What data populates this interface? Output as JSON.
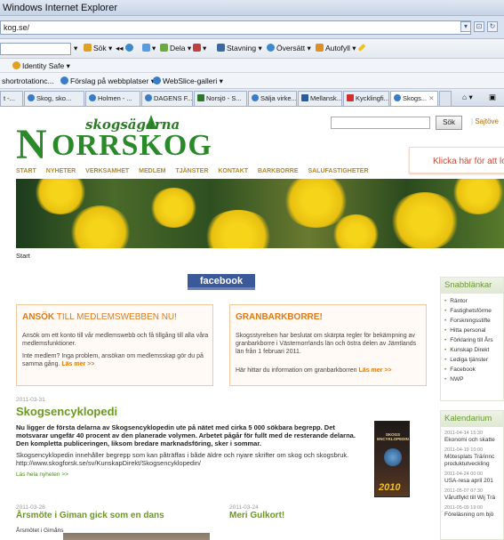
{
  "window": {
    "title": "Windows Internet Explorer"
  },
  "address": {
    "url": "kog.se/"
  },
  "command_bar": {
    "search_label": "Sök",
    "share_label": "Dela",
    "spelling_label": "Stavning",
    "translate_label": "Översätt",
    "autofill_label": "Autofyll"
  },
  "identity": {
    "label": "Identity Safe"
  },
  "favorites": {
    "item1": "shortrotationc...",
    "item2": "Förslag på webbplatser",
    "item3": "WebSlice-galleri"
  },
  "tabs": [
    "t -...",
    "Skog, sko...",
    "Holmen - ...",
    "DAGENS F...",
    "Norsjö - S...",
    "Sälja virke...",
    "Mellansk...",
    "Kycklingfi...",
    "Skogs..."
  ],
  "site": {
    "logo_sub": "skogsägarna",
    "logo_main": "ORRSKOG",
    "logo_n": "N",
    "search_button": "Sök",
    "sitemap_link": "Sajtöve",
    "promo_text": "Klicka här för att lo",
    "nav": [
      "START",
      "NYHETER",
      "VERKSAMHET",
      "MEDLEM",
      "TJÄNSTER",
      "KONTAKT",
      "BARKBORRE",
      "SALUFASTIGHETER"
    ],
    "breadcrumb": "Start",
    "facebook": "facebook"
  },
  "box_apply": {
    "title_bold": "ANSÖK",
    "title_rest": " TILL MEDLEMSWEBBEN NU!",
    "text1": "Ansök om ett konto till vår medlemswebb och få tillgång till alla våra medlemsfunktioner.",
    "text2": "Inte medlem? Inga problem, ansökan om medlemsskap gör du på samma gång.",
    "more": "Läs mer >>"
  },
  "box_bark": {
    "title": "GRANBARKBORRE!",
    "text1": "Skogsstyrelsen har beslutat om skärpta regler för bekämpning av granbarkborre i Västernorrlands län och östra delen av Jämtlands län från 1 februari 2011.",
    "text2": "Här hittar du information om granbarkborren",
    "more": "Läs mer >>"
  },
  "article": {
    "date": "2011-03-31",
    "headline": "Skogsencyklopedi",
    "lead": "Nu ligger de första delarna av Skogsencyklopedin ute på nätet med cirka 5 000 sökbara begrepp. Det motsvarar ungefär 40 procent av den planerade volymen. Arbetet pågår för fullt med de resterande delarna. Den kompletta publiceringen, liksom bredare marknadsföring, sker i sommar.",
    "body": "Skogsencyklopedin innehåller begrepp som kan påträffas i både äldre och nyare skrifter om skog och skogsbruk. http://www.skogforsk.se/sv/KunskapDirekt/Skogsencyklopedin/",
    "read_more": "Läs hela nyheten >>",
    "book_title": "SKOGS ENCYKLOPEDIN",
    "book_year": "2010"
  },
  "news2": {
    "date": "2011-03-28",
    "headline": "Årsmöte i Giman gick som en dans",
    "text": "Årsmötet i Gimåns"
  },
  "news3": {
    "date": "2011-03-24",
    "headline": "Meri Gulkort!"
  },
  "quicklinks": {
    "title": "Snabblänkar",
    "items": [
      "Räntor",
      "Fastighetsförme",
      "Forskningsstifte",
      "Hitta personal",
      "Förklaring till Års",
      "Kunskap Direkt",
      "Lediga tjänster",
      "Facebook",
      "NWP"
    ]
  },
  "calendar": {
    "title": "Kalendarium",
    "items": [
      {
        "date": "2011-04-14 15:30",
        "title": "Ekonomi och skatte"
      },
      {
        "date": "2011-04-19 10:00",
        "title": "Mötesplats Trä/innc"
      },
      {
        "date": "",
        "title": "produktutveckling"
      },
      {
        "date": "2011-04-24 00:00",
        "title": "USA-resa april 201"
      },
      {
        "date": "2011-05-07 07:30",
        "title": "Vårutflykt till Wij Trä"
      },
      {
        "date": "2011-05-09 19:00",
        "title": "Föreläsning om bjö"
      }
    ]
  },
  "colors": {
    "brand_green": "#2a8a2a",
    "accent_orange": "#e07a15",
    "facebook_blue": "#3b5998"
  }
}
